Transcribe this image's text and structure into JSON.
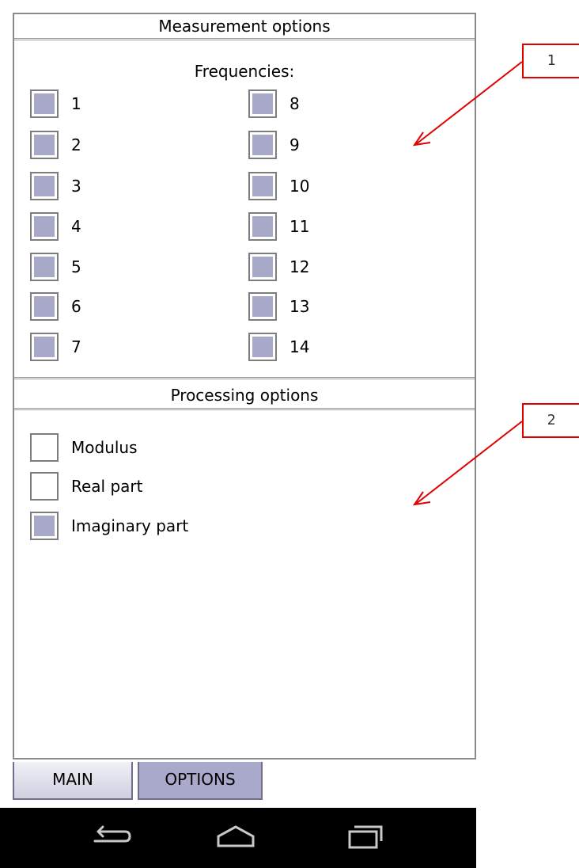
{
  "measurement": {
    "header": "Measurement options",
    "subheader": "Frequencies:",
    "frequencies_left": [
      {
        "label": "1",
        "checked": true
      },
      {
        "label": "2",
        "checked": true
      },
      {
        "label": "3",
        "checked": true
      },
      {
        "label": "4",
        "checked": true
      },
      {
        "label": "5",
        "checked": true
      },
      {
        "label": "6",
        "checked": true
      },
      {
        "label": "7",
        "checked": true
      }
    ],
    "frequencies_right": [
      {
        "label": "8",
        "checked": true
      },
      {
        "label": "9",
        "checked": true
      },
      {
        "label": "10",
        "checked": true
      },
      {
        "label": "11",
        "checked": true
      },
      {
        "label": "12",
        "checked": true
      },
      {
        "label": "13",
        "checked": true
      },
      {
        "label": "14",
        "checked": true
      }
    ]
  },
  "processing": {
    "header": "Processing options",
    "options": [
      {
        "label": "Modulus",
        "checked": false
      },
      {
        "label": "Real part",
        "checked": false
      },
      {
        "label": "Imaginary part",
        "checked": true
      }
    ]
  },
  "tabs": [
    {
      "label": "MAIN",
      "active": false
    },
    {
      "label": "OPTIONS",
      "active": true
    }
  ],
  "annotations": [
    {
      "label": "1"
    },
    {
      "label": "2"
    }
  ],
  "colors": {
    "checked_fill": "#a8a8c8",
    "active_tab": "#a9a9cc",
    "annotation": "#e00000"
  },
  "icons": [
    "back-icon",
    "home-icon",
    "recent-apps-icon"
  ]
}
